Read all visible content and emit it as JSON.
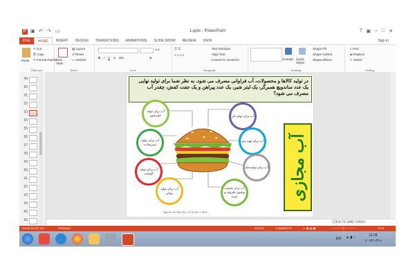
{
  "window": {
    "title": "1.pptx - PowerPoint"
  },
  "tabs": [
    "FILE",
    "HOME",
    "INSERT",
    "DESIGN",
    "TRANSITIONS",
    "ANIMATIONS",
    "SLIDE SHOW",
    "REVIEW",
    "VIEW"
  ],
  "active_tab": "HOME",
  "account": {
    "sign_in": "Sign in"
  },
  "ribbon": {
    "clipboard": {
      "paste": "Paste",
      "cut": "Cut",
      "copy": "Copy",
      "format_painter": "Format Painter",
      "label": "Clipboard"
    },
    "slides": {
      "new_slide": "New Slide",
      "layout": "Layout",
      "reset": "Reset",
      "section": "Section",
      "label": "Slides"
    },
    "font": {
      "label": "Font"
    },
    "paragraph": {
      "text_direction": "Text Direction",
      "align_text": "Align Text",
      "convert_smartart": "Convert to SmartArt",
      "label": "Paragraph"
    },
    "drawing": {
      "arrange": "Arrange",
      "quick_styles": "Quick Styles",
      "shape_fill": "Shape Fill",
      "shape_outline": "Shape Outline",
      "shape_effects": "Shape Effects",
      "label": "Drawing"
    },
    "editing": {
      "find": "Find",
      "replace": "Replace",
      "select": "Select",
      "label": "Editing"
    }
  },
  "thumbnails": {
    "numbers": [
      "49",
      "50",
      "51",
      "52",
      "53",
      "54",
      "55",
      "56",
      "57",
      "58",
      "59",
      "60",
      "61",
      "62",
      "63",
      "64",
      "65",
      "66"
    ],
    "active": "53"
  },
  "slide": {
    "question": "در تولید کالاها و محصولات، آب فراوانی مصرف می شود. به نظر شما برای تولید نهایی یک عدد ساندویچ همبرگر، یک لیتر شیر، یک عدد پیراهن و یک جفت کفش، چقدر آب مصرف می شود؟",
    "circles": [
      {
        "text": "آب برای تولید خیارشور",
        "color": "#8ec63f"
      },
      {
        "text": "آب برای تولید سبزیجات",
        "color": "#3aa54a"
      },
      {
        "text": "آب برای تولید گوشت",
        "color": "#e5262d"
      },
      {
        "text": "آب برای تولید روغن",
        "color": "#f2b91d"
      },
      {
        "text": "آب برای تولید نان",
        "color": "#6a5aa8"
      },
      {
        "text": "آب برای تهیه پنیر",
        "color": "#00a7e1"
      },
      {
        "text": "آب برای تولیدنمک",
        "color": "#9b9b9b"
      },
      {
        "text": "آب برای شست وشوی ظروف و غیره",
        "color": "#7cb93f"
      }
    ],
    "side_title": "آب مجازی",
    "caption": "شکل ۱- مصرف آب برای تولید یک ساندویچ"
  },
  "notes": {
    "placeholder": "Click to add notes"
  },
  "status": {
    "slide_info": "SLIDE 53 OF 120",
    "language": "PERSIAN",
    "notes": "NOTES",
    "comments": "COMMENTS",
    "zoom": "73 %"
  },
  "taskbar": {
    "lang": "EN",
    "time": "12:29",
    "date": "۲۰۲۴/۰۳/۱۱"
  }
}
